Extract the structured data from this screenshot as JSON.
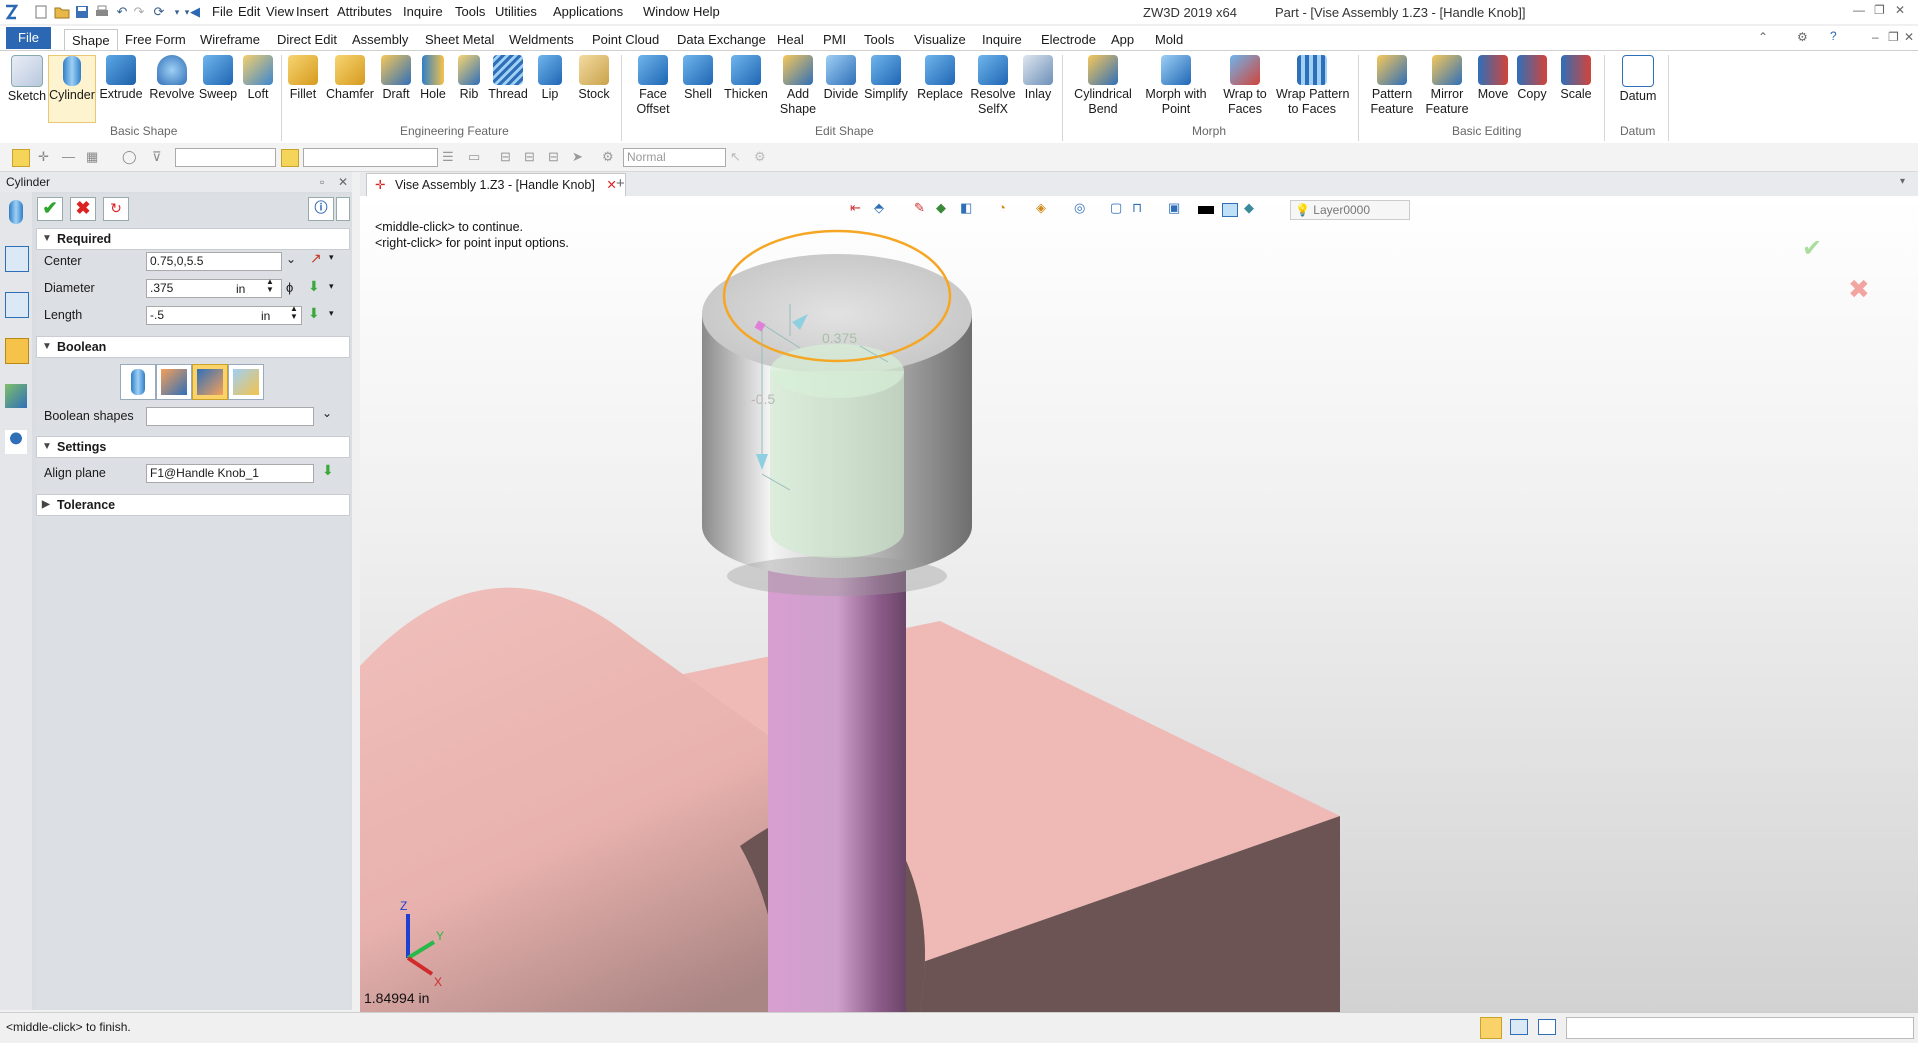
{
  "app": {
    "title": "ZW3D 2019  x64",
    "document": "Part - [Vise Assembly 1.Z3 - [Handle Knob]]"
  },
  "menu": [
    "File",
    "Edit",
    "View",
    "Insert",
    "Attributes",
    "Inquire",
    "Tools",
    "Utilities",
    "Applications",
    "Window",
    "Help"
  ],
  "ribbon_tabs": [
    "File",
    "Shape",
    "Free Form",
    "Wireframe",
    "Direct Edit",
    "Assembly",
    "Sheet Metal",
    "Weldments",
    "Point Cloud",
    "Data Exchange",
    "Heal",
    "PMI",
    "Tools",
    "Visualize",
    "Inquire",
    "Electrode",
    "App",
    "Mold"
  ],
  "active_tab": "Shape",
  "ribbon": {
    "basic_shape": [
      "Sketch",
      "Cylinder",
      "Extrude",
      "Revolve",
      "Sweep",
      "Loft"
    ],
    "engineering_feature": [
      "Fillet",
      "Chamfer",
      "Draft",
      "Hole",
      "Rib",
      "Thread",
      "Lip",
      "Stock"
    ],
    "edit_shape": [
      "Face\nOffset",
      "Shell",
      "Thicken",
      "Add\nShape",
      "Divide",
      "Simplify",
      "Replace",
      "Resolve\nSelfX",
      "Inlay"
    ],
    "morph": [
      "Cylindrical\nBend",
      "Morph with\nPoint",
      "Wrap to\nFaces",
      "Wrap Pattern\nto Faces"
    ],
    "basic_editing": [
      "Pattern\nFeature",
      "Mirror\nFeature",
      "Move",
      "Copy",
      "Scale"
    ],
    "datum": [
      "Datum"
    ],
    "groups": [
      "Basic Shape",
      "Engineering Feature",
      "Edit Shape",
      "Morph",
      "Basic Editing",
      "Datum"
    ]
  },
  "toolbar2": {
    "style_combo": "Normal",
    "layer": "Layer0000"
  },
  "panel": {
    "title": "Cylinder",
    "required_label": "Required",
    "center_label": "Center",
    "center_value": "0.75,0,5.5",
    "diameter_label": "Diameter",
    "diameter_value": ".375",
    "diameter_unit": "in",
    "length_label": "Length",
    "length_value": "-.5",
    "length_unit": "in",
    "boolean_label": "Boolean",
    "boolean_shapes_label": "Boolean shapes",
    "settings_label": "Settings",
    "align_plane_label": "Align plane",
    "align_plane_value": "F1@Handle Knob_1",
    "tolerance_label": "Tolerance"
  },
  "doc_tab": "Vise Assembly 1.Z3 - [Handle Knob]",
  "viewport": {
    "hint1": "<middle-click> to continue.",
    "hint2": "<right-click> for point input options.",
    "dim_diameter": "0.375",
    "dim_length": "-0.5",
    "measure": "1.84994 in",
    "axis_x": "X",
    "axis_y": "Y",
    "axis_z": "Z"
  },
  "status": {
    "message": "<middle-click> to finish."
  },
  "colors": {
    "accent": "#2b67b3",
    "highlight": "#f5a623",
    "pink": "#eeb8b4",
    "purple": "#c99ac4"
  }
}
